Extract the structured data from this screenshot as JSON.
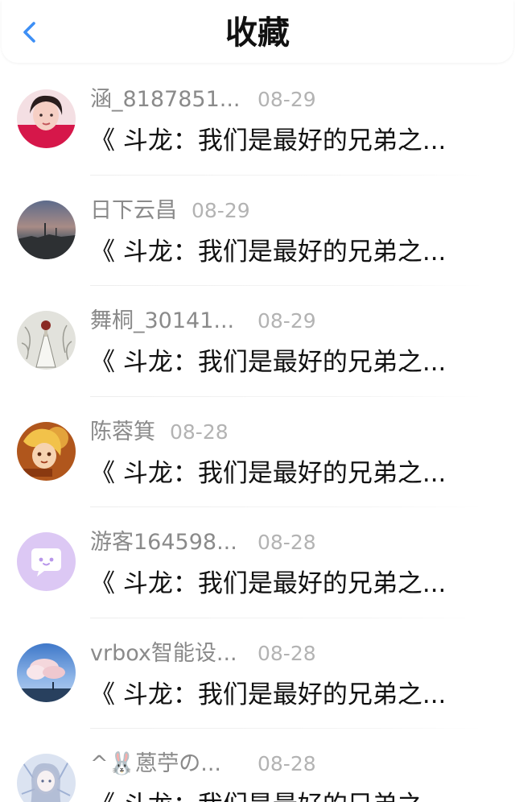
{
  "header": {
    "title": "收藏",
    "back_icon": "chevron-left-icon",
    "accent": "#3d8ff5"
  },
  "items": [
    {
      "name": "涵_8187851...",
      "date": "08-29",
      "title": "《 斗龙：我们是最好的兄弟之..."
    },
    {
      "name": "日下云昌",
      "date": "08-29",
      "title": "《 斗龙：我们是最好的兄弟之..."
    },
    {
      "name": "舞桐_30141...",
      "date": "08-29",
      "title": "《 斗龙：我们是最好的兄弟之..."
    },
    {
      "name": "陈蓉箕",
      "date": "08-28",
      "title": "《 斗龙：我们是最好的兄弟之..."
    },
    {
      "name": "游客164598...",
      "date": "08-28",
      "title": "《 斗龙：我们是最好的兄弟之..."
    },
    {
      "name": "vrbox智能设...",
      "date": "08-28",
      "title": "《 斗龙：我们是最好的兄弟之..."
    },
    {
      "name": "^🐰蒽苧の...",
      "date": "08-28",
      "title": "《 斗龙：我们是最好的兄弟之..."
    }
  ]
}
